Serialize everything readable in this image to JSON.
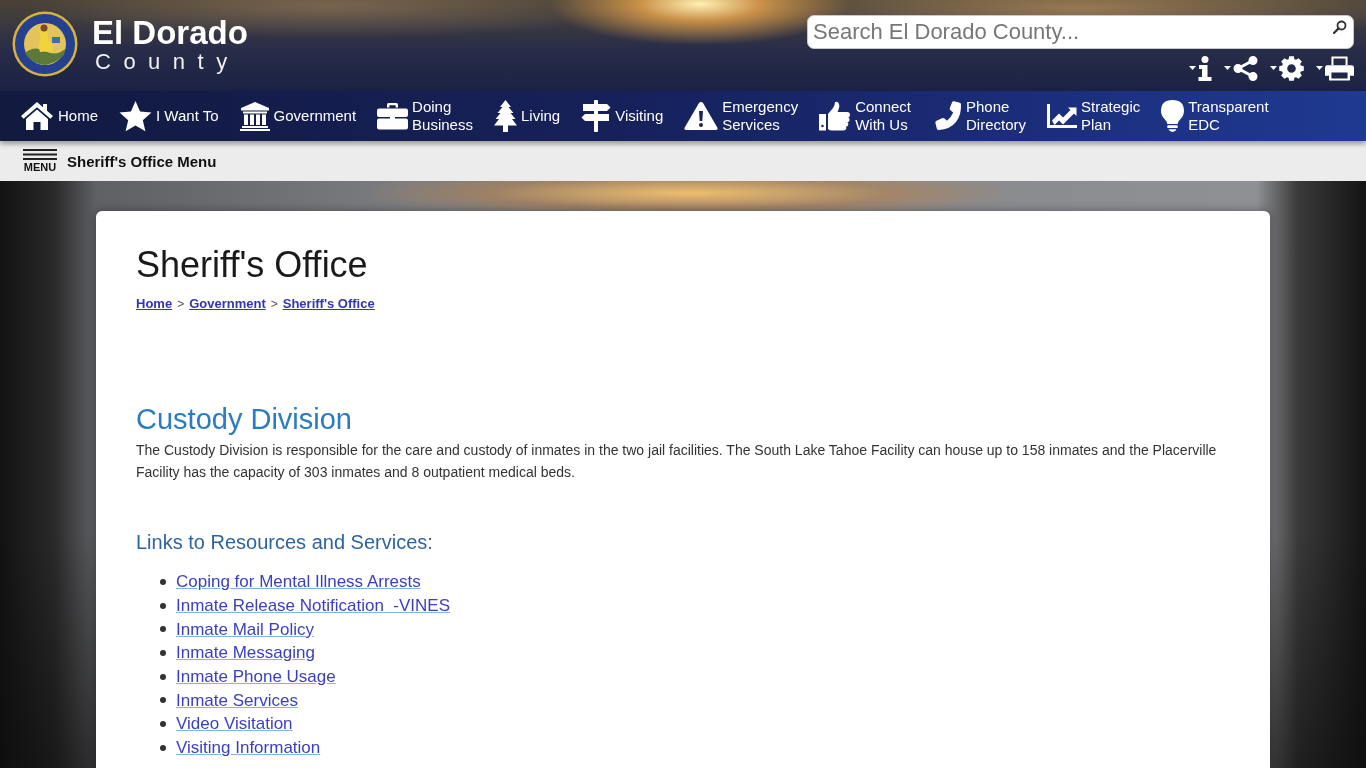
{
  "header": {
    "title": "El Dorado",
    "subtitle": "County",
    "search": {
      "placeholder": "Search El Dorado County..."
    }
  },
  "nav": [
    {
      "kind": "home",
      "lines": [
        "Home"
      ]
    },
    {
      "kind": "star",
      "lines": [
        "I Want To"
      ]
    },
    {
      "kind": "building",
      "lines": [
        "Government"
      ]
    },
    {
      "kind": "briefcase",
      "lines": [
        "Doing",
        "Business"
      ]
    },
    {
      "kind": "tree",
      "lines": [
        "Living"
      ]
    },
    {
      "kind": "signpost",
      "lines": [
        "Visiting"
      ]
    },
    {
      "kind": "warning",
      "lines": [
        "Emergency",
        "Services"
      ]
    },
    {
      "kind": "thumb",
      "lines": [
        "Connect",
        "With Us"
      ]
    },
    {
      "kind": "phone",
      "lines": [
        "Phone",
        "Directory"
      ]
    },
    {
      "kind": "chart",
      "lines": [
        "Strategic",
        "Plan"
      ]
    },
    {
      "kind": "bulb",
      "lines": [
        "Transparent",
        "EDC"
      ]
    }
  ],
  "section_menu": {
    "button_label": "MENU",
    "title": "Sheriff's Office Menu"
  },
  "content": {
    "title": "Sheriff's Office",
    "breadcrumb": [
      {
        "kind": "link",
        "label": "Home"
      },
      {
        "kind": "separator",
        "label": ">"
      },
      {
        "kind": "link",
        "label": "Government"
      },
      {
        "kind": "separator",
        "label": ">"
      },
      {
        "kind": "link",
        "label": "Sheriff's Office"
      }
    ],
    "section_title": "Custody Division",
    "intro": "The Custody Division is responsible for the care and custody of inmates in the two jail facilities. The South Lake Tahoe Facility can house up to 158 inmates and the Placerville Facility has the capacity of 303 inmates and 8 outpatient medical beds.",
    "links_heading": "Links to Resources and Services:",
    "links": [
      "Coping for Mental Illness Arrests",
      "Inmate Release Notification  -VINES",
      "Inmate Mail Policy",
      "Inmate Messaging",
      "Inmate Phone Usage",
      "Inmate Services",
      "Video Visitation",
      "Visiting Information"
    ]
  }
}
